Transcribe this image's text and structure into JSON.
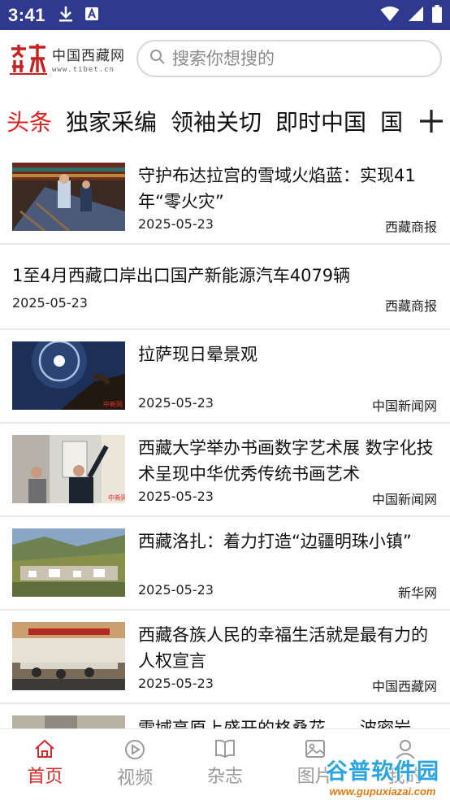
{
  "status_bar": {
    "time": "3:41",
    "download_icon": "download-icon",
    "app_icon": "a-icon",
    "wifi_icon": "wifi-icon",
    "signal_icon": "signal-icon",
    "battery_icon": "battery-icon"
  },
  "header": {
    "logo_cn": "中国西藏网",
    "logo_en": "www.tibet.cn",
    "search_placeholder": "搜索你想搜的"
  },
  "tabs": [
    "头条",
    "独家采编",
    "领袖关切",
    "即时中国",
    "国"
  ],
  "active_tab": 0,
  "news": [
    {
      "title": "守护布达拉宫的雪域火焰蓝：实现41年“零火灾”",
      "date": "2025-05-23",
      "source": "西藏商报",
      "image": true
    },
    {
      "title": "1至4月西藏口岸出口国产新能源汽车4079辆",
      "date": "2025-05-23",
      "source": "西藏商报",
      "image": false
    },
    {
      "title": "拉萨现日晕景观",
      "date": "2025-05-23",
      "source": "中国新闻网",
      "image": true
    },
    {
      "title": "西藏大学举办书画数字艺术展 数字化技术呈现中华优秀传统书画艺术",
      "date": "2025-05-23",
      "source": "中国新闻网",
      "image": true
    },
    {
      "title": "西藏洛扎：着力打造“边疆明珠小镇”",
      "date": "2025-05-23",
      "source": "新华网",
      "image": true
    },
    {
      "title": "西藏各族人民的幸福生活就是最有力的人权宣言",
      "date": "2025-05-23",
      "source": "中国西藏网",
      "image": true
    },
    {
      "title": "雪域高原上盛开的格桑花——波密岩",
      "date": "",
      "source": "",
      "image": true
    }
  ],
  "bottom_nav": [
    {
      "label": "首页",
      "icon": "home-icon"
    },
    {
      "label": "视频",
      "icon": "play-icon"
    },
    {
      "label": "杂志",
      "icon": "book-icon"
    },
    {
      "label": "图片",
      "icon": "image-icon"
    },
    {
      "label": "我的",
      "icon": "user-icon"
    }
  ],
  "watermark": {
    "text": "谷普软件园",
    "url": "www.gupuxiazai.com"
  },
  "colors": {
    "status_bar": "#2f3a8f",
    "accent": "#e02020",
    "nav_active": "#d42a2a"
  }
}
